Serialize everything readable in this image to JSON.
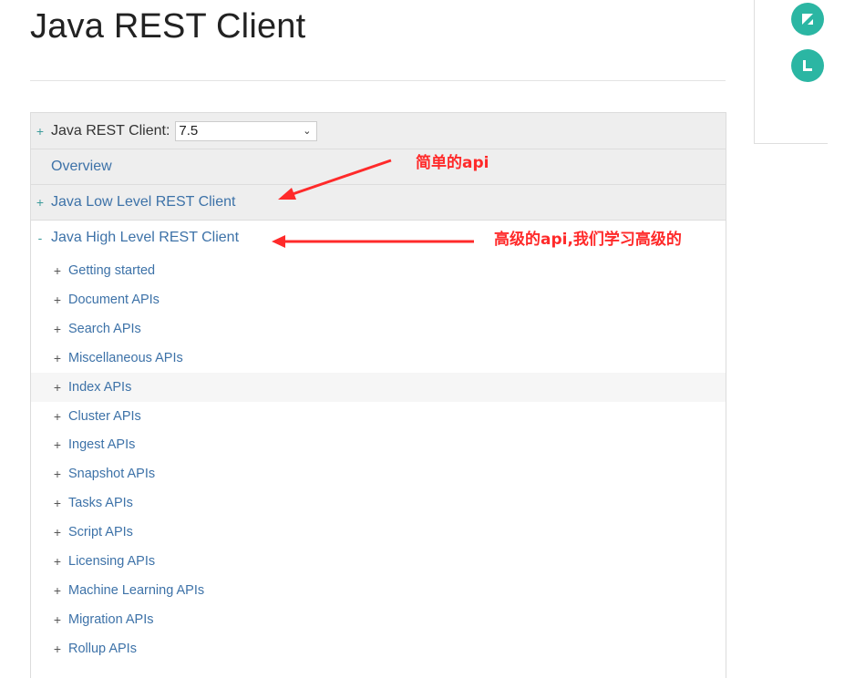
{
  "page": {
    "title": "Java REST Client"
  },
  "nav": {
    "version_label": "Java REST Client:",
    "version_value": "7.5",
    "overview": "Overview",
    "low_level": "Java Low Level REST Client",
    "high_level": "Java High Level REST Client",
    "sub_items": [
      "Getting started",
      "Document APIs",
      "Search APIs",
      "Miscellaneous APIs",
      "Index APIs",
      "Cluster APIs",
      "Ingest APIs",
      "Snapshot APIs",
      "Tasks APIs",
      "Script APIs",
      "Licensing APIs",
      "Machine Learning APIs",
      "Migration APIs",
      "Rollup APIs"
    ]
  },
  "annotations": {
    "simple": "简单的api",
    "advanced": "高级的api,我们学习高级的"
  },
  "colors": {
    "accent": "#3d72a8",
    "annotation": "#ff2a2a",
    "icon": "#2bb6a3"
  }
}
